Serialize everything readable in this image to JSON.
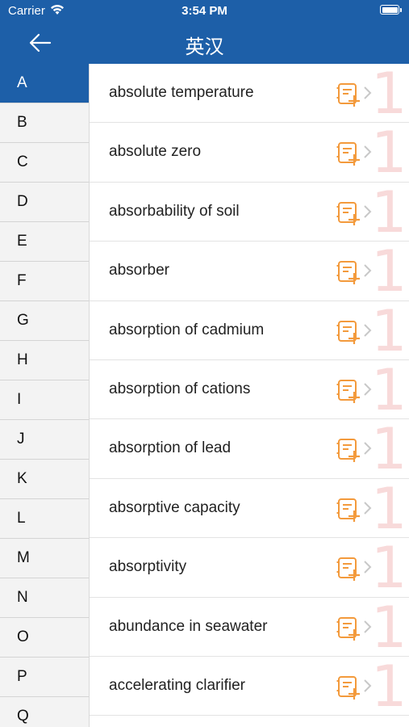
{
  "status_bar": {
    "carrier": "Carrier",
    "time": "3:54 PM"
  },
  "nav": {
    "title": "英汉"
  },
  "sidebar": {
    "letters": [
      "A",
      "B",
      "C",
      "D",
      "E",
      "F",
      "G",
      "H",
      "I",
      "J",
      "K",
      "L",
      "M",
      "N",
      "O",
      "P",
      "Q"
    ],
    "active": "A"
  },
  "list": {
    "items": [
      {
        "term": "absolute temperature",
        "rank": "1"
      },
      {
        "term": "absolute zero",
        "rank": "1"
      },
      {
        "term": "absorbability of soil",
        "rank": "1"
      },
      {
        "term": "absorber",
        "rank": "1"
      },
      {
        "term": "absorption of cadmium",
        "rank": "1"
      },
      {
        "term": "absorption of cations",
        "rank": "1"
      },
      {
        "term": "absorption of lead",
        "rank": "1"
      },
      {
        "term": "absorptive capacity",
        "rank": "1"
      },
      {
        "term": "absorptivity",
        "rank": "1"
      },
      {
        "term": "abundance in seawater",
        "rank": "1"
      },
      {
        "term": "accelerating clarifier",
        "rank": "1"
      }
    ]
  },
  "colors": {
    "header": "#1d5fa8",
    "icon": "#f39a3c",
    "rank_number": "#f8dada"
  },
  "icons": {
    "back": "back-arrow-icon",
    "add": "add-to-notebook-icon",
    "chevron": "chevron-right-icon"
  }
}
